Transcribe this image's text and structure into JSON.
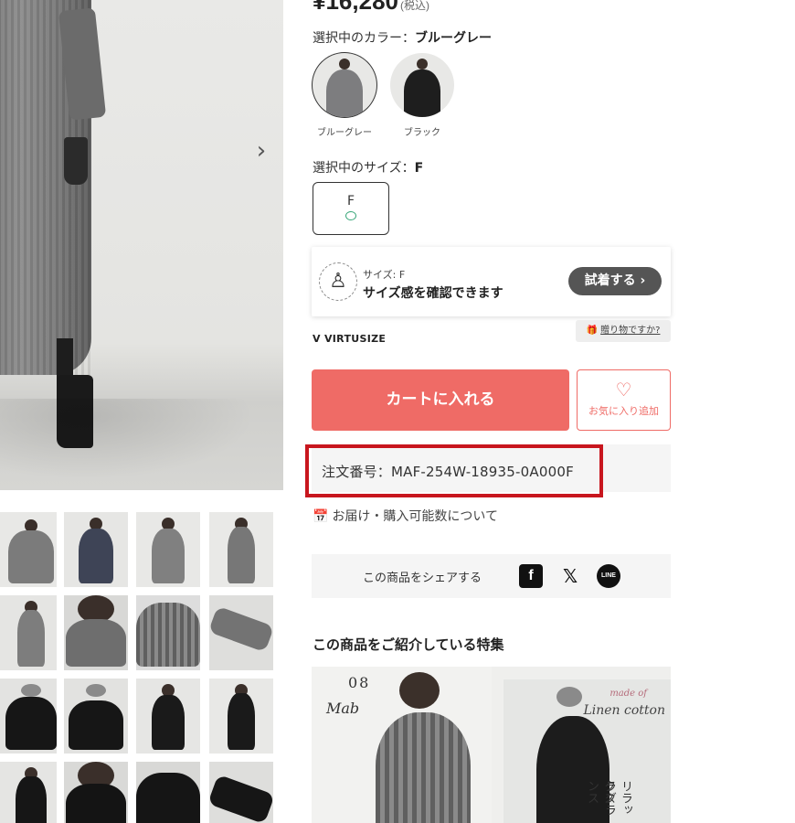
{
  "price": {
    "amount": "¥16,280",
    "tax_note": "(税込)"
  },
  "color_selector": {
    "label": "選択中のカラー：",
    "selected_value": "ブルーグレー",
    "options": [
      {
        "name": "ブルーグレー",
        "tone": "#7d7d7f",
        "selected": true
      },
      {
        "name": "ブラック",
        "tone": "#1e1e1e",
        "selected": false
      }
    ]
  },
  "size_selector": {
    "label": "選択中のサイズ：",
    "selected_value": "F",
    "options": [
      {
        "name": "F",
        "stock_mark": "available"
      }
    ]
  },
  "virtusize": {
    "size_text": "サイズ: F",
    "message": "サイズ感を確認できます",
    "try_button": "試着する ›",
    "logo": "VIRTUSIZE",
    "gift_link": "贈り物ですか?"
  },
  "actions": {
    "cart_button": "カートに入れる",
    "favorite_icon": "♡",
    "favorite_label": "お気に入り追加"
  },
  "order_number": "注文番号：MAF-254W-18935-0A000F",
  "highlight_color": "#c8161e",
  "delivery_link": "お届け・購入可能数について",
  "share": {
    "label": "この商品をシェアする",
    "facebook_icon": "f",
    "x_icon": "𝕏",
    "line_icon": "LINE"
  },
  "feature": {
    "title": "この商品をご紹介している特集",
    "banner": {
      "number": "08",
      "mab": "Mab",
      "small_text": "",
      "made_of": "made of",
      "linen": "Linen cotton",
      "vertical_1": "リラックス",
      "vertical_2": "ラグランス"
    }
  },
  "thumbnails": [
    "gray-dress-front",
    "gray-dress-with-coat",
    "gray-dress-model",
    "gray-dress-side",
    "gray-dress-back",
    "gray-dress-neck-back",
    "gray-dress-pleats",
    "gray-dress-sleeve",
    "black-dress-beret",
    "black-dress-beret-close",
    "black-dress-full",
    "black-dress-side",
    "black-dress-detail",
    "black-dress-neck-back",
    "black-dress-neck",
    "black-dress-sleeve"
  ],
  "colors": {
    "accent": "#ef6b66",
    "dark_button": "#555555",
    "panel_bg": "#f5f5f5"
  },
  "icons": {
    "next": "›",
    "calendar": "📅",
    "gift": "🎁",
    "person": "♙"
  }
}
